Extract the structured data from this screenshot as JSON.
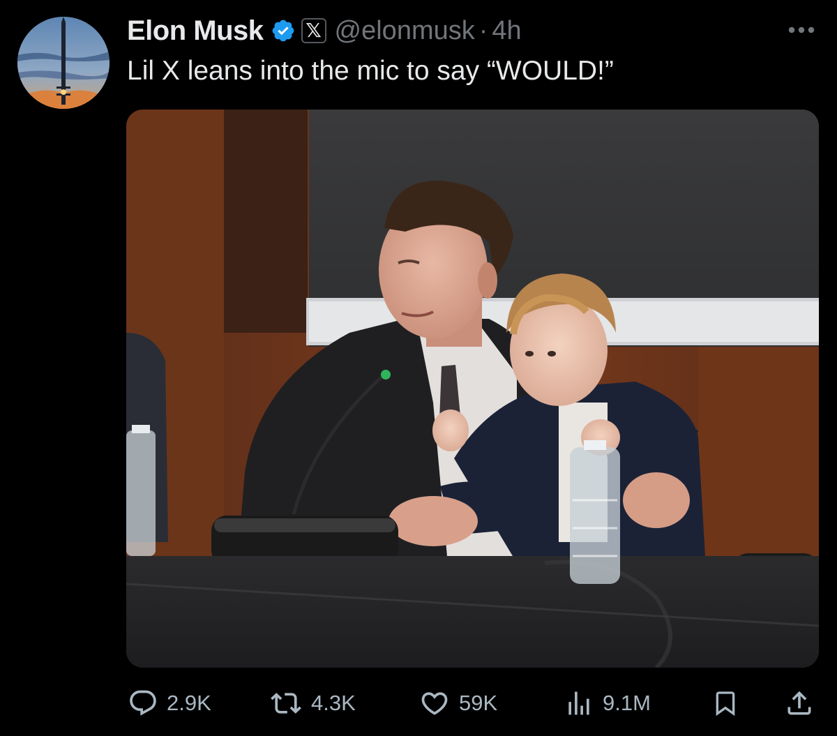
{
  "tweet": {
    "author_name": "Elon Musk",
    "handle": "@elonmusk",
    "separator": "·",
    "time": "4h",
    "affiliation_badge": "𝕏",
    "text": "Lil X leans into the mic to say “WOULD!”",
    "verified_color": "#1d9bf0"
  },
  "actions": {
    "replies": "2.9K",
    "reposts": "4.3K",
    "likes": "59K",
    "views": "9.1M"
  },
  "icons": {
    "avatar": "rocket-launch-avatar",
    "verified": "verified-badge-icon",
    "more": "more-icon",
    "reply": "reply-icon",
    "repost": "repost-icon",
    "like": "heart-icon",
    "views": "views-icon",
    "bookmark": "bookmark-icon",
    "share": "share-icon"
  }
}
